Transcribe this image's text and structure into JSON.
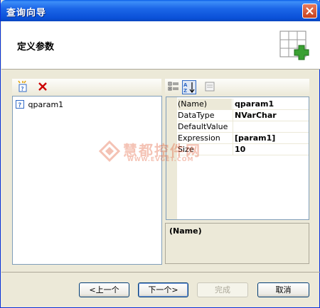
{
  "window": {
    "title": "查询向导"
  },
  "header": {
    "title": "定义参数"
  },
  "params": {
    "items": [
      "qparam1"
    ]
  },
  "properties": {
    "rows": [
      {
        "name": "(Name)",
        "value": "qparam1"
      },
      {
        "name": "DataType",
        "value": "NVarChar"
      },
      {
        "name": "DefaultValue",
        "value": ""
      },
      {
        "name": "Expression",
        "value": "[param1]"
      },
      {
        "name": "Size",
        "value": "10"
      }
    ],
    "description_title": "(Name)"
  },
  "watermark": {
    "title": "慧都控件网",
    "url": "WWW.EVGET.COM"
  },
  "buttons": {
    "back": "<上一个",
    "next": "下一个>",
    "finish": "完成",
    "cancel": "取消"
  },
  "colors": {
    "accent": "#316ac5",
    "delete_red": "#cc0000",
    "add_green": "#3aa032"
  }
}
